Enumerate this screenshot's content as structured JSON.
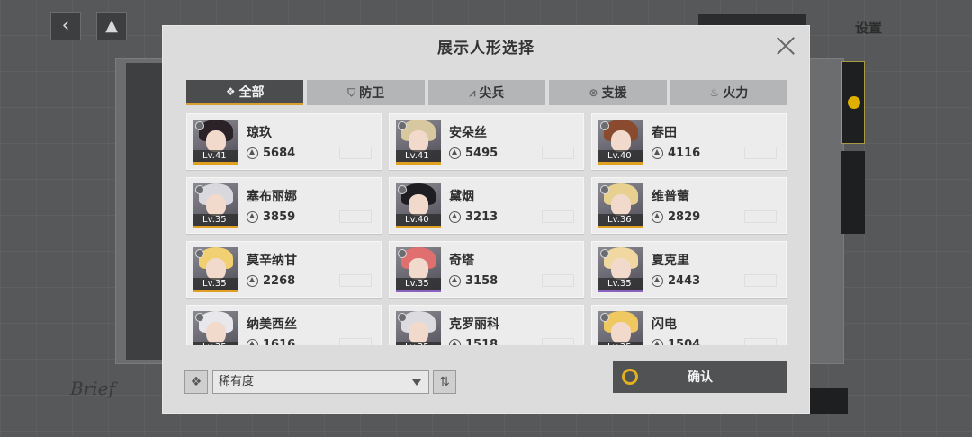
{
  "background": {
    "settings_label": "设置",
    "brief_text": "Brief"
  },
  "modal": {
    "title": "展示人形选择",
    "tabs": [
      {
        "label": "全部",
        "icon": "diamond-grid-icon",
        "active": true
      },
      {
        "label": "防卫",
        "icon": "shield-icon",
        "active": false
      },
      {
        "label": "尖兵",
        "icon": "spearhead-icon",
        "active": false
      },
      {
        "label": "支援",
        "icon": "support-icon",
        "active": false
      },
      {
        "label": "火力",
        "icon": "firepower-icon",
        "active": false
      }
    ],
    "characters": [
      {
        "name": "琼玖",
        "level": "Lv.41",
        "power": "5684",
        "rarity_color": "#e0a020",
        "hair": "#2a2226"
      },
      {
        "name": "安朵丝",
        "level": "Lv.41",
        "power": "5495",
        "rarity_color": "#e0a020",
        "hair": "#d8c8a0"
      },
      {
        "name": "春田",
        "level": "Lv.40",
        "power": "4116",
        "rarity_color": "#e0a020",
        "hair": "#8a4a30"
      },
      {
        "name": "塞布丽娜",
        "level": "Lv.35",
        "power": "3859",
        "rarity_color": "#e0a020",
        "hair": "#d8d8de"
      },
      {
        "name": "黛烟",
        "level": "Lv.40",
        "power": "3213",
        "rarity_color": "#e0a020",
        "hair": "#1e1e22"
      },
      {
        "name": "维普蕾",
        "level": "Lv.36",
        "power": "2829",
        "rarity_color": "#e0a020",
        "hair": "#e8d090"
      },
      {
        "name": "莫辛纳甘",
        "level": "Lv.35",
        "power": "2268",
        "rarity_color": "#e0a020",
        "hair": "#f0d070"
      },
      {
        "name": "奇塔",
        "level": "Lv.35",
        "power": "3158",
        "rarity_color": "#8a60c0",
        "hair": "#e07070"
      },
      {
        "name": "夏克里",
        "level": "Lv.35",
        "power": "2443",
        "rarity_color": "#8a60c0",
        "hair": "#f0d8a0"
      },
      {
        "name": "纳美西丝",
        "level": "Lv.35",
        "power": "1616",
        "rarity_color": "#e0a020",
        "hair": "#e8e8ec"
      },
      {
        "name": "克罗丽科",
        "level": "Lv.35",
        "power": "1518",
        "rarity_color": "#e0a020",
        "hair": "#dcdce0"
      },
      {
        "name": "闪电",
        "level": "Lv.35",
        "power": "1504",
        "rarity_color": "#e0a020",
        "hair": "#f0c860"
      }
    ],
    "sort_label": "稀有度",
    "confirm_label": "确认"
  }
}
